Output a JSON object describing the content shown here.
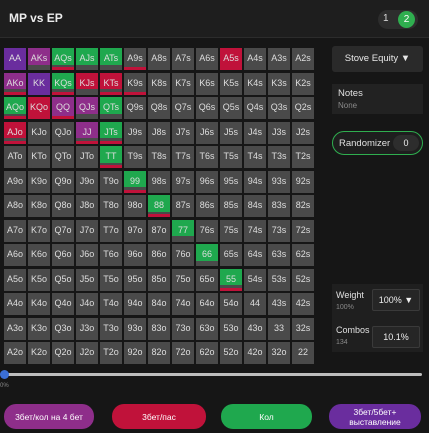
{
  "header": {
    "title": "MP vs EP",
    "page_current": "1",
    "page_total": "2"
  },
  "matrix_rows": [
    [
      "AA",
      "AKs",
      "AQs",
      "AJs",
      "ATs",
      "A9s",
      "A8s",
      "A7s",
      "A6s",
      "A5s",
      "A4s",
      "A3s",
      "A2s"
    ],
    [
      "AKo",
      "KK",
      "KQs",
      "KJs",
      "KTs",
      "K9s",
      "K8s",
      "K7s",
      "K6s",
      "K5s",
      "K4s",
      "K3s",
      "K2s"
    ],
    [
      "AQo",
      "KQo",
      "QQ",
      "QJs",
      "QTs",
      "Q9s",
      "Q8s",
      "Q7s",
      "Q6s",
      "Q5s",
      "Q4s",
      "Q3s",
      "Q2s"
    ],
    [
      "AJo",
      "KJo",
      "QJo",
      "JJ",
      "JTs",
      "J9s",
      "J8s",
      "J7s",
      "J6s",
      "J5s",
      "J4s",
      "J3s",
      "J2s"
    ],
    [
      "ATo",
      "KTo",
      "QTo",
      "JTo",
      "TT",
      "T9s",
      "T8s",
      "T7s",
      "T6s",
      "T5s",
      "T4s",
      "T3s",
      "T2s"
    ],
    [
      "A9o",
      "K9o",
      "Q9o",
      "J9o",
      "T9o",
      "99",
      "98s",
      "97s",
      "96s",
      "95s",
      "94s",
      "93s",
      "92s"
    ],
    [
      "A8o",
      "K8o",
      "Q8o",
      "J8o",
      "T8o",
      "98o",
      "88",
      "87s",
      "86s",
      "85s",
      "84s",
      "83s",
      "82s"
    ],
    [
      "A7o",
      "K7o",
      "Q7o",
      "J7o",
      "T7o",
      "97o",
      "87o",
      "77",
      "76s",
      "75s",
      "74s",
      "73s",
      "72s"
    ],
    [
      "A6o",
      "K6o",
      "Q6o",
      "J6o",
      "T6o",
      "96o",
      "86o",
      "76o",
      "66",
      "65s",
      "64s",
      "63s",
      "62s"
    ],
    [
      "A5o",
      "K5o",
      "Q5o",
      "J5o",
      "T5o",
      "95o",
      "85o",
      "75o",
      "65o",
      "55",
      "54s",
      "53s",
      "52s"
    ],
    [
      "A4o",
      "K4o",
      "Q4o",
      "J4o",
      "T4o",
      "94o",
      "84o",
      "74o",
      "64o",
      "54o",
      "44",
      "43s",
      "42s"
    ],
    [
      "A3o",
      "K3o",
      "Q3o",
      "J3o",
      "T3o",
      "93o",
      "83o",
      "73o",
      "63o",
      "53o",
      "43o",
      "33",
      "32s"
    ],
    [
      "A2o",
      "K2o",
      "Q2o",
      "J2o",
      "T2o",
      "92o",
      "82o",
      "72o",
      "62o",
      "52o",
      "42o",
      "32o",
      "22"
    ]
  ],
  "actions": {
    "purple": {
      "label": "3бет/кол на 4 бет",
      "color": "#8e2e8a"
    },
    "red": {
      "label": "3бет/пас",
      "color": "#c0123a"
    },
    "green": {
      "label": "Кол",
      "color": "#1fa84e"
    },
    "violet": {
      "label": "3бет/5бет+ выставление",
      "color": "#6a2d9e"
    }
  },
  "hand_actions": {
    "AA": [
      [
        "violet",
        1
      ]
    ],
    "AKs": [
      [
        "purple",
        1
      ]
    ],
    "AQs": [
      [
        "green",
        1
      ]
    ],
    "AJs": [
      [
        "green",
        1
      ]
    ],
    "ATs": [
      [
        "green",
        1
      ]
    ],
    "A9s": [
      [
        "red",
        0.8
      ]
    ],
    "A5s": [
      [
        "red",
        1
      ]
    ],
    "AKo": [
      [
        "purple",
        1
      ]
    ],
    "KK": [
      [
        "violet",
        1
      ]
    ],
    "KQs": [
      [
        "green",
        1
      ]
    ],
    "KJs": [
      [
        "red",
        1
      ]
    ],
    "KTs": [
      [
        "red",
        1
      ]
    ],
    "K9s": [
      [
        "red",
        0.6
      ]
    ],
    "AQo": [
      [
        "green",
        1
      ]
    ],
    "KQo": [
      [
        "red",
        1
      ]
    ],
    "QQ": [
      [
        "purple",
        1
      ]
    ],
    "QJs": [
      [
        "purple",
        1
      ]
    ],
    "QTs": [
      [
        "green",
        1
      ]
    ],
    "AJo": [
      [
        "red",
        1
      ]
    ],
    "JJ": [
      [
        "purple",
        1
      ]
    ],
    "JTs": [
      [
        "green",
        1
      ]
    ],
    "TT": [
      [
        "green",
        1
      ]
    ],
    "99": [
      [
        "green",
        1
      ]
    ],
    "88": [
      [
        "green",
        1
      ]
    ],
    "77": [
      [
        "green",
        1
      ]
    ],
    "66": [
      [
        "green",
        1
      ]
    ],
    "55": [
      [
        "green",
        1
      ]
    ]
  },
  "partial_fill": {
    "AKs": 0.75,
    "AQs": 0.75,
    "AJs": 0.75,
    "ATs": 0.75,
    "KQs": 0.75,
    "KJs": 0.75,
    "KTs": 0.75,
    "AQo": 0.75,
    "QJs": 0.75,
    "QTs": 0.75,
    "AJo": 0.75,
    "JJ": 0.75,
    "JTs": 0.75,
    "TT": 0.75,
    "AKo": 0.75,
    "99": 0.75,
    "88": 0.75,
    "77": 0.75,
    "66": 0.75,
    "55": 0.75
  },
  "underline": {
    "A9s": "red",
    "A5s": "red",
    "K9s": "red",
    "AJo": "red",
    "JJ": "red",
    "JTs": "red",
    "TT": "red",
    "KTs": "red",
    "99": "red",
    "88": "red",
    "55": "red",
    "AQs": "red",
    "KQs": "red",
    "AQo": "red",
    "AKo": "red",
    "QQ": "red",
    "KQo": "red"
  },
  "sidebar": {
    "stove_label": "Stove Equity ▼",
    "notes_title": "Notes",
    "notes_value": "None",
    "randomizer_label": "Randomizer",
    "randomizer_value": "0",
    "weight_label": "Weight",
    "weight_sub": "100%",
    "weight_value": "100% ▼",
    "combos_label": "Combos",
    "combos_sub": "134",
    "combos_value": "10.1%"
  },
  "slider": {
    "value_label": "0%",
    "value": 0
  }
}
